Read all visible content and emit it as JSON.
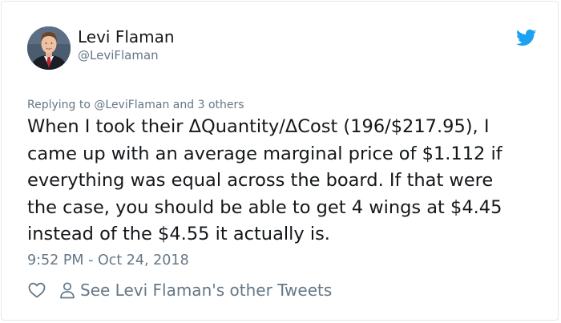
{
  "author": {
    "display_name": "Levi Flaman",
    "handle": "@LeviFlaman",
    "avatar_icon": "profile-photo",
    "platform_icon": "twitter-bird-icon"
  },
  "reply_context": {
    "prefix": "Replying to",
    "mention": "@LeviFlaman",
    "suffix": "and 3 others"
  },
  "tweet": {
    "lines": [
      "When I took their ΔQuantity/ΔCost (196/$217.95), I",
      "came up with an average marginal price of $1.112 if",
      "everything was equal across the board. If that were",
      "the case, you should be able to get 4 wings at $4.45",
      "instead of the $4.55 it actually is."
    ]
  },
  "timestamp": "9:52 PM - Oct 24, 2018",
  "actions": {
    "like_icon": "heart-icon",
    "profile_icon": "person-icon",
    "other_tweets_label": "See Levi Flaman's other Tweets"
  },
  "colors": {
    "text_primary": "#14171a",
    "text_secondary": "#657786",
    "twitter_blue": "#1da1f2",
    "border": "#e1e8ed"
  }
}
